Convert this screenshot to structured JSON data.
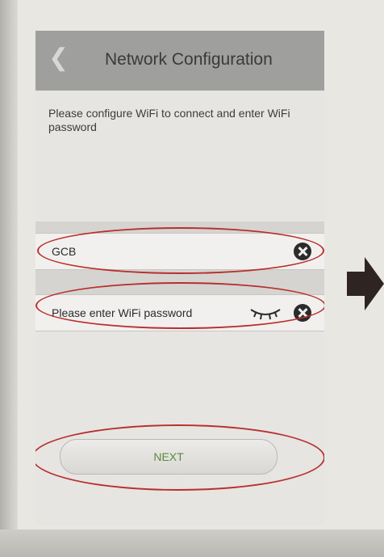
{
  "header": {
    "title": "Network Configuration"
  },
  "instructions": {
    "text": "Please configure WiFi to connect and enter WiFi password"
  },
  "wifi": {
    "ssid_value": "GCB",
    "password_placeholder": "Please enter WiFi password"
  },
  "actions": {
    "next_label": "NEXT"
  },
  "icons": {
    "back": "chevron-left-icon",
    "clear": "clear-icon",
    "password_visibility": "eye-closed-icon",
    "next_step": "arrow-right-icon"
  },
  "colors": {
    "header_bg": "#9f9f9e",
    "title_text": "#3a3a3a",
    "next_text": "#5a8a3a",
    "annotation_red": "#b8302e",
    "arrow": "#2e2522"
  }
}
